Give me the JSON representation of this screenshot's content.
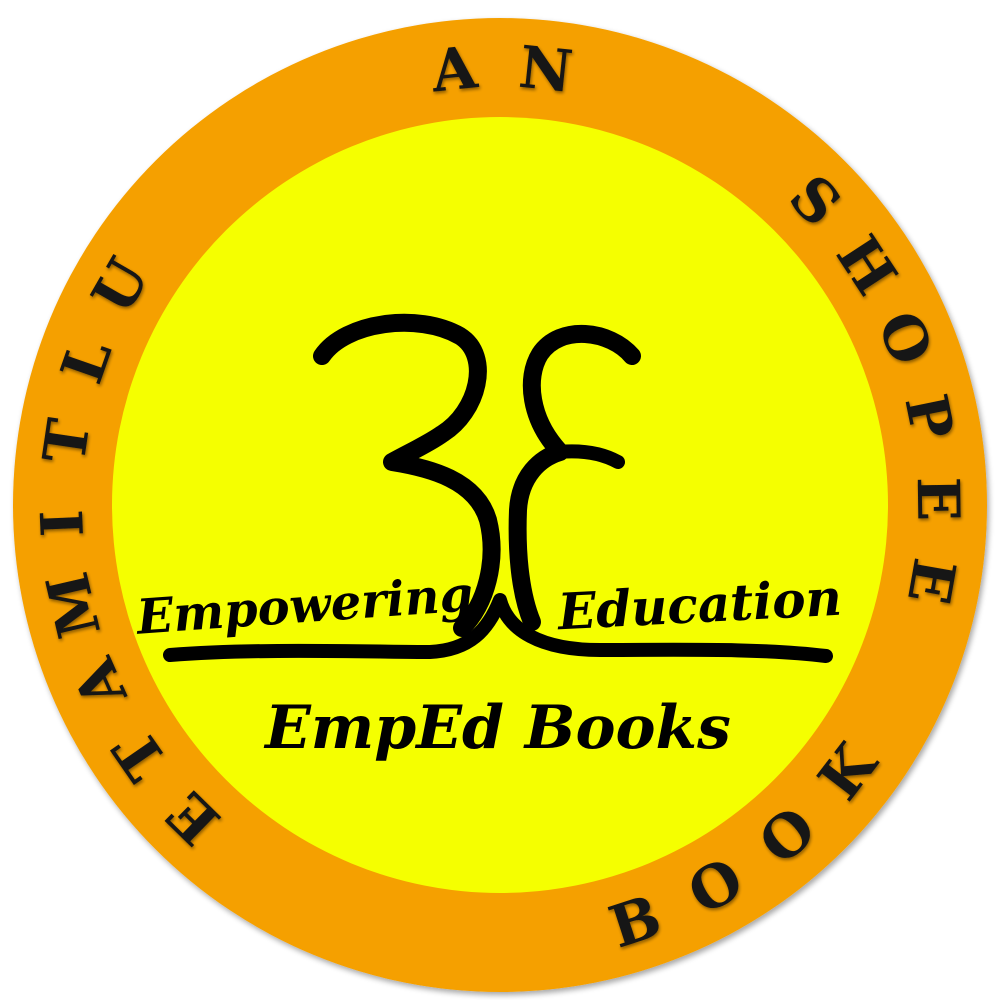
{
  "logo": {
    "ring_letters": {
      "top": "AN",
      "left": "ULTIMATE",
      "right": "SHOPEE",
      "bottom": "BOOK"
    },
    "monogram": "3E",
    "tagline_left": "Empowering",
    "tagline_right": "Education",
    "brand_name": "EmpEd Books"
  },
  "colors": {
    "ring": "#F5A000",
    "disc": "#F5FF00",
    "ink": "#000000"
  }
}
